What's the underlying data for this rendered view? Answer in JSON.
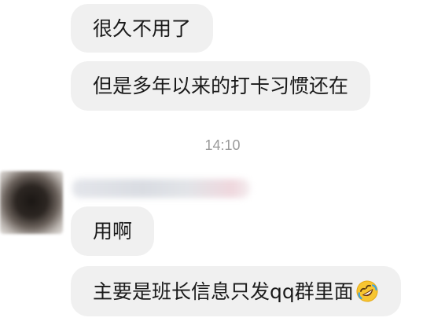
{
  "messages": [
    {
      "text": "很久不用了"
    },
    {
      "text": "但是多年以来的打卡习惯还在"
    }
  ],
  "timestamp": "14:10",
  "incoming": [
    {
      "text": "用啊"
    },
    {
      "text": "主要是班长信息只发qq群里面",
      "emoji": "rolling-on-floor-laughing-icon"
    }
  ]
}
